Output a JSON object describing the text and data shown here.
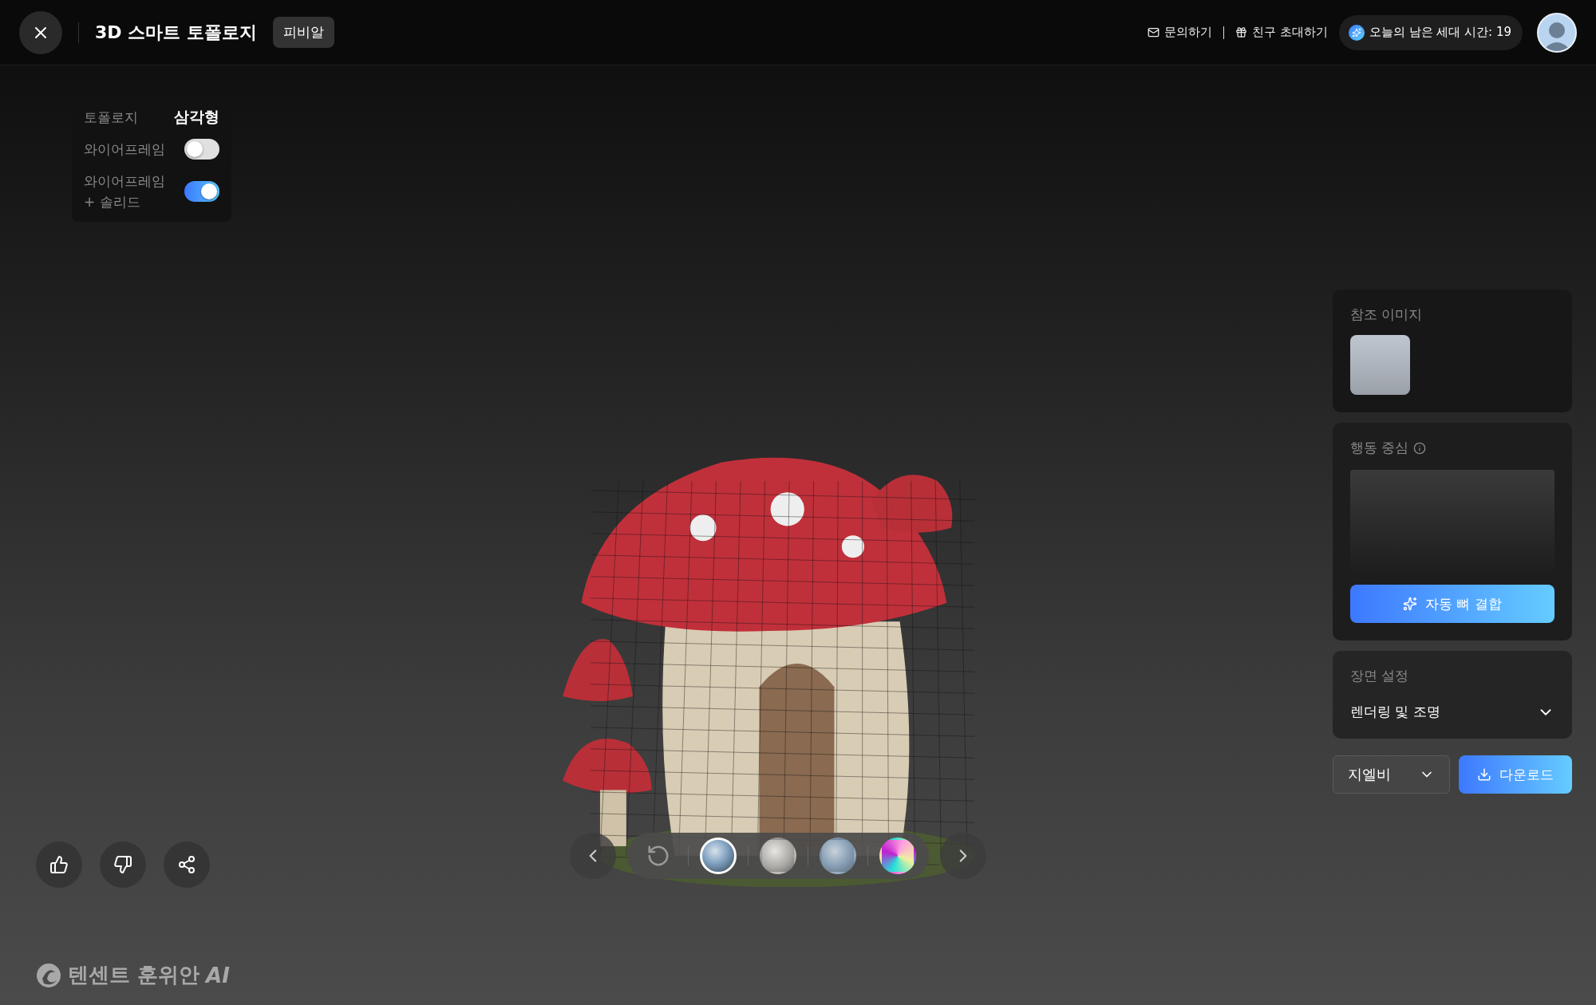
{
  "header": {
    "title": "3D 스마트 토폴로지",
    "badge": "피비알",
    "links": [
      {
        "kind": "mail",
        "label": "문의하기"
      },
      {
        "kind": "gift",
        "label": "친구 초대하기"
      }
    ],
    "quota": "오늘의 남은 세대 시간: 19"
  },
  "topology_panel": {
    "label": "토폴로지",
    "value": "삼각형",
    "toggles": [
      {
        "lines": [
          "와이어프레임"
        ],
        "on": false
      },
      {
        "lines": [
          "와이어프레임",
          "+ 솔리드"
        ],
        "on": true
      }
    ]
  },
  "viewer_tools": [
    {
      "kind": "rotate",
      "selected": false
    },
    {
      "kind": "textured",
      "selected": true
    },
    {
      "kind": "clay",
      "selected": false
    },
    {
      "kind": "matte",
      "selected": false
    },
    {
      "kind": "normal",
      "selected": false
    }
  ],
  "logo": {
    "text": "텐센트 훈위안",
    "suffix": "AI"
  },
  "reference": {
    "title": "참조 이미지"
  },
  "motion": {
    "title": "행동 중심",
    "button": "자동 뼈 결합"
  },
  "scene": {
    "title": "장면 설정",
    "dropdown": "렌더링 및 조명"
  },
  "format": "지엘비",
  "download": "다운로드"
}
